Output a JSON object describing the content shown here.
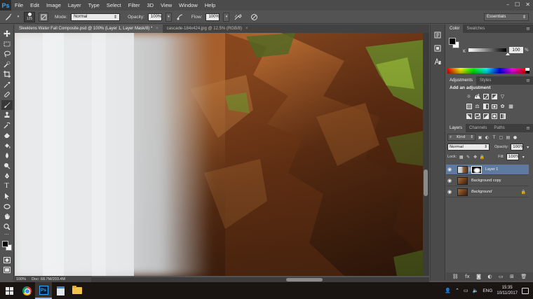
{
  "app": {
    "logo": "Ps"
  },
  "menu": [
    "File",
    "Edit",
    "Image",
    "Layer",
    "Type",
    "Select",
    "Filter",
    "3D",
    "View",
    "Window",
    "Help"
  ],
  "window_controls": [
    "–",
    "☐",
    "✕"
  ],
  "options_bar": {
    "brush_size": "125",
    "mode_label": "Mode:",
    "mode_value": "Normal",
    "opacity_label": "Opacity:",
    "opacity_value": "100%",
    "flow_label": "Flow:",
    "flow_value": "100%",
    "workspace": "Essentials"
  },
  "document_tabs": [
    {
      "label": "Sleeklens Water Fall Composite.psd @ 100% (Layer 1, Layer Mask/8) *",
      "close": "×"
    },
    {
      "label": "cascade-184x424.jpg @ 12.5% (RGB/8)",
      "close": "×"
    }
  ],
  "status": {
    "zoom": "100%",
    "doc": "Doc: 68.7M/203.4M"
  },
  "color_panel": {
    "tabs": [
      "Color",
      "Swatches"
    ],
    "channel": "K",
    "value": "100",
    "unit": "%"
  },
  "adjustments_panel": {
    "tabs": [
      "Adjustments",
      "Styles"
    ],
    "title": "Add an adjustment"
  },
  "layers_panel": {
    "tabs": [
      "Layers",
      "Channels",
      "Paths"
    ],
    "filter_kind": "Kind",
    "blend_mode": "Normal",
    "opacity_label": "Opacity:",
    "opacity_value": "100%",
    "lock_label": "Lock:",
    "fill_label": "Fill:",
    "fill_value": "100%",
    "layers": [
      {
        "name": "Layer 1",
        "selected": true
      },
      {
        "name": "Background copy",
        "selected": false
      },
      {
        "name": "Background",
        "selected": false
      }
    ]
  },
  "taskbar": {
    "lang": "ENG",
    "time": "15:35",
    "date": "10/11/2017"
  }
}
